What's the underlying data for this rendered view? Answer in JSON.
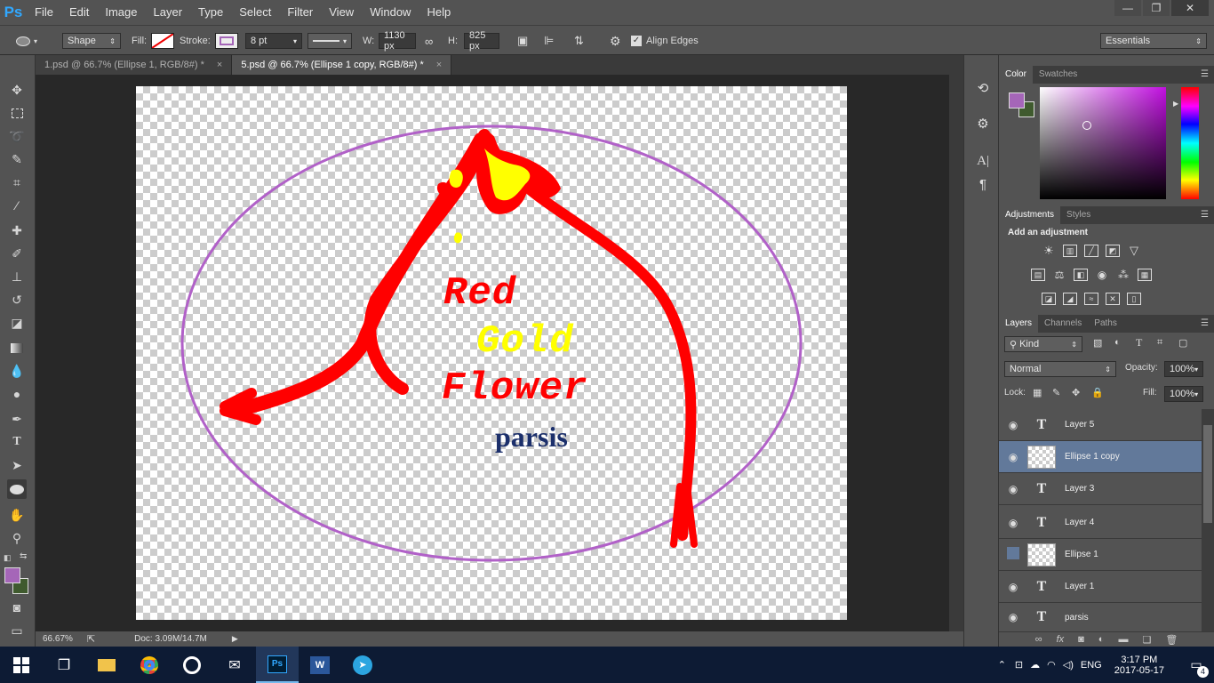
{
  "app": {
    "logo": "Ps"
  },
  "menu": [
    "File",
    "Edit",
    "Image",
    "Layer",
    "Type",
    "Select",
    "Filter",
    "View",
    "Window",
    "Help"
  ],
  "window_controls": {
    "minimize": "—",
    "restore": "❐",
    "close": "✕"
  },
  "options": {
    "mode": "Shape",
    "fill_label": "Fill:",
    "stroke_label": "Stroke:",
    "stroke_size": "8 pt",
    "w_label": "W:",
    "width": "1130 px",
    "h_label": "H:",
    "height": "825 px",
    "align_edges": "Align Edges",
    "workspace": "Essentials"
  },
  "tabs": [
    {
      "label": "1.psd @ 66.7% (Ellipse 1, RGB/8#) *",
      "close": "×"
    },
    {
      "label": "5.psd @ 66.7% (Ellipse 1 copy, RGB/8#) *",
      "close": "×"
    }
  ],
  "artwork": {
    "line1": "Red",
    "line2": "Gold",
    "line3": "Flower",
    "line4": "parsis",
    "colors": {
      "red": "#ff0000",
      "gold": "#ffff00",
      "navy": "#1b2f6b",
      "ellipse": "#b161c8"
    }
  },
  "status": {
    "zoom": "66.67%",
    "doc": "Doc: 3.09M/14.7M"
  },
  "color_panel": {
    "tabs": [
      "Color",
      "Swatches"
    ],
    "foreground": "#a566b8",
    "background": "#3f5a2e"
  },
  "adjustments": {
    "tabs": [
      "Adjustments",
      "Styles"
    ],
    "heading": "Add an adjustment"
  },
  "layers_panel": {
    "tabs": [
      "Layers",
      "Channels",
      "Paths"
    ],
    "kind": "Kind",
    "blend_mode": "Normal",
    "opacity_label": "Opacity:",
    "opacity": "100%",
    "lock_label": "Lock:",
    "fill_label": "Fill:",
    "fill": "100%",
    "layers": [
      {
        "name": "Layer 5",
        "type": "text",
        "visible": true,
        "selected": false
      },
      {
        "name": "Ellipse 1 copy",
        "type": "shape",
        "visible": true,
        "selected": true
      },
      {
        "name": "Layer 3",
        "type": "text",
        "visible": true,
        "selected": false
      },
      {
        "name": "Layer 4",
        "type": "text",
        "visible": true,
        "selected": false
      },
      {
        "name": "Ellipse 1",
        "type": "shape",
        "visible": false,
        "selected": false
      },
      {
        "name": "Layer 1",
        "type": "text",
        "visible": true,
        "selected": false
      },
      {
        "name": "parsis",
        "type": "text",
        "visible": true,
        "selected": false
      }
    ],
    "footer_icons": [
      "link-icon",
      "fx-icon",
      "mask-icon",
      "adjustment-icon",
      "folder-icon",
      "new-layer-icon",
      "trash-icon"
    ]
  },
  "taskbar": {
    "time": "3:17 PM",
    "date": "2017-05-17",
    "lang": "ENG",
    "notifications": "4"
  }
}
